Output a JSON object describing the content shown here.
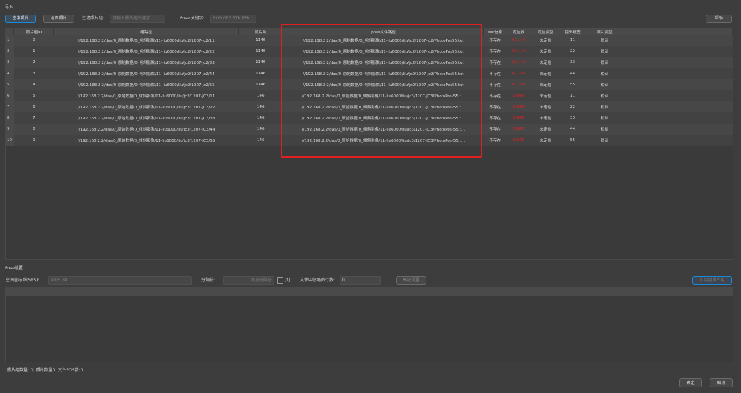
{
  "import_section": {
    "title": "导入"
  },
  "toolbar": {
    "aerial_button": "空中照片",
    "ground_button": "地面照片",
    "filter_label": "过滤照片组:",
    "filter_placeholder": "请输入照片组关键字",
    "pose_key_label": "Pose 关键字:",
    "pose_key_placeholder": "POS,GPS,RTK,PPK",
    "help_button": "帮助"
  },
  "table": {
    "columns": [
      "照片组ID",
      "组路径",
      "照片数",
      "pose文件路径",
      "exif信息",
      "定位数",
      "定位类型",
      "镜头标签",
      "照片类型"
    ],
    "rows": [
      {
        "num": "1",
        "id": "0",
        "path": "//192.168.2.2/das/0_原始数据/0_倾斜影像/11-liu6000/liu/jc2/1207-jc2/11",
        "count": "1146",
        "pose": "//192.168.2.2/das/0_原始数据/0_倾斜影像/11-liu6000/liu/jc2/1207-jc2/PhotoPos55.txt",
        "exif": "不存在",
        "loc": "0/1146",
        "loctype": "未定位",
        "lens": "11",
        "type": "默认"
      },
      {
        "num": "2",
        "id": "1",
        "path": "//192.168.2.2/das/0_原始数据/0_倾斜影像/11-liu6000/liu/jc2/1207-jc2/22",
        "count": "1146",
        "pose": "//192.168.2.2/das/0_原始数据/0_倾斜影像/11-liu6000/liu/jc2/1207-jc2/PhotoPos55.txt",
        "exif": "不存在",
        "loc": "0/1146",
        "loctype": "未定位",
        "lens": "22",
        "type": "默认"
      },
      {
        "num": "3",
        "id": "2",
        "path": "//192.168.2.2/das/0_原始数据/0_倾斜影像/11-liu6000/liu/jc2/1207-jc2/33",
        "count": "1146",
        "pose": "//192.168.2.2/das/0_原始数据/0_倾斜影像/11-liu6000/liu/jc2/1207-jc2/PhotoPos55.txt",
        "exif": "不存在",
        "loc": "0/1146",
        "loctype": "未定位",
        "lens": "33",
        "type": "默认"
      },
      {
        "num": "4",
        "id": "3",
        "path": "//192.168.2.2/das/0_原始数据/0_倾斜影像/11-liu6000/liu/jc2/1207-jc2/44",
        "count": "1146",
        "pose": "//192.168.2.2/das/0_原始数据/0_倾斜影像/11-liu6000/liu/jc2/1207-jc2/PhotoPos55.txt",
        "exif": "不存在",
        "loc": "0/1146",
        "loctype": "未定位",
        "lens": "44",
        "type": "默认"
      },
      {
        "num": "5",
        "id": "4",
        "path": "//192.168.2.2/das/0_原始数据/0_倾斜影像/11-liu6000/liu/jc2/1207-jc2/55",
        "count": "1146",
        "pose": "//192.168.2.2/das/0_原始数据/0_倾斜影像/11-liu6000/liu/jc2/1207-jc2/PhotoPos55.txt",
        "exif": "不存在",
        "loc": "0/1146",
        "loctype": "未定位",
        "lens": "55",
        "type": "默认"
      },
      {
        "num": "6",
        "id": "5",
        "path": "//192.168.2.2/das/0_原始数据/0_倾斜影像/11-liu6000/liu/jc3/1207-JC3/11",
        "count": "146",
        "pose": "//192.168.2.2/das/0_原始数据/0_倾斜影像/11-liu6000/liu/jc3/1207-JC3/PhotoPos-55.t...",
        "exif": "不存在",
        "loc": "0/146",
        "loctype": "未定位",
        "lens": "11",
        "type": "默认"
      },
      {
        "num": "7",
        "id": "6",
        "path": "//192.168.2.2/das/0_原始数据/0_倾斜影像/11-liu6000/liu/jc3/1207-JC3/22",
        "count": "146",
        "pose": "//192.168.2.2/das/0_原始数据/0_倾斜影像/11-liu6000/liu/jc3/1207-JC3/PhotoPos-55.t...",
        "exif": "不存在",
        "loc": "0/146",
        "loctype": "未定位",
        "lens": "22",
        "type": "默认"
      },
      {
        "num": "8",
        "id": "7",
        "path": "//192.168.2.2/das/0_原始数据/0_倾斜影像/11-liu6000/liu/jc3/1207-JC3/33",
        "count": "146",
        "pose": "//192.168.2.2/das/0_原始数据/0_倾斜影像/11-liu6000/liu/jc3/1207-JC3/PhotoPos-55.t...",
        "exif": "不存在",
        "loc": "0/146",
        "loctype": "未定位",
        "lens": "33",
        "type": "默认"
      },
      {
        "num": "9",
        "id": "8",
        "path": "//192.168.2.2/das/0_原始数据/0_倾斜影像/11-liu6000/liu/jc3/1207-JC3/44",
        "count": "146",
        "pose": "//192.168.2.2/das/0_原始数据/0_倾斜影像/11-liu6000/liu/jc3/1207-JC3/PhotoPos-55.t...",
        "exif": "不存在",
        "loc": "0/146",
        "loctype": "未定位",
        "lens": "44",
        "type": "默认"
      },
      {
        "num": "10",
        "id": "9",
        "path": "//192.168.2.2/das/0_原始数据/0_倾斜影像/11-liu6000/liu/jc3/1207-JC3/55",
        "count": "146",
        "pose": "//192.168.2.2/das/0_原始数据/0_倾斜影像/11-liu6000/liu/jc3/1207-JC3/PhotoPos-55.t...",
        "exif": "不存在",
        "loc": "0/146",
        "loctype": "未定位",
        "lens": "55",
        "type": "默认"
      }
    ]
  },
  "pose_settings": {
    "title": "Pose设置",
    "srs_label": "空间坐标系(SRS):",
    "srs_value": "WGS 84",
    "separator_label": "分隔符:",
    "separator_placeholder": "添加分隔符",
    "tab_label": "[t]",
    "ignore_rows_label": "文件中忽略的行数:",
    "ignore_rows_value": "0",
    "advanced_button": "高级设置",
    "apply_button": "应用到照片组"
  },
  "status_text": "照片组数量: 0; 照片数量0; 文件POS数:0",
  "ok_button": "确定",
  "cancel_button": "取消",
  "colors": {
    "highlight": "#e02020",
    "accent": "#1a8ad8",
    "loc_count": "#e02020"
  }
}
